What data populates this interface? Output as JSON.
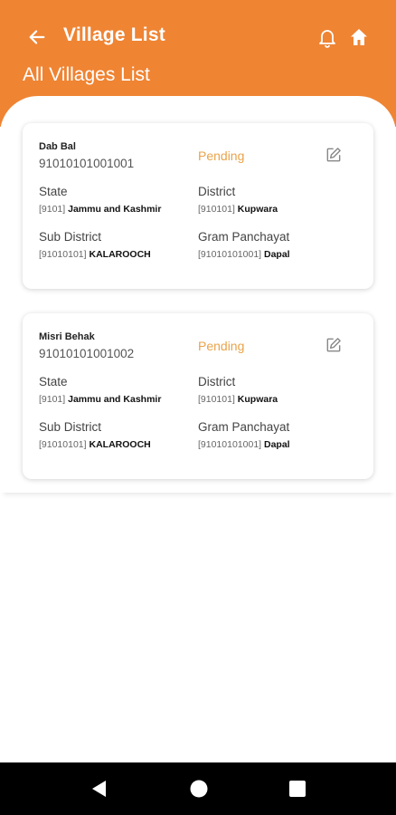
{
  "header": {
    "title": "Village List",
    "subtitle": "All Villages List",
    "icons": [
      "back-arrow-icon",
      "bell-icon",
      "home-icon"
    ],
    "accent_color": "#ef8433"
  },
  "villages": [
    {
      "name": "Dab Bal",
      "code": "91010101001001",
      "status": "Pending",
      "state_label": "State",
      "state_code": "[9101]",
      "state_name": "Jammu and Kashmir",
      "district_label": "District",
      "district_code": "[910101]",
      "district_name": "Kupwara",
      "subdistrict_label": "Sub District",
      "subdistrict_code": "[91010101]",
      "subdistrict_name": "KALAROOCH",
      "panchayat_label": "Gram Panchayat",
      "panchayat_code": "[91010101001]",
      "panchayat_name": "Dapal"
    },
    {
      "name": "Misri Behak",
      "code": "91010101001002",
      "status": "Pending",
      "state_label": "State",
      "state_code": "[9101]",
      "state_name": "Jammu and Kashmir",
      "district_label": "District",
      "district_code": "[910101]",
      "district_name": "Kupwara",
      "subdistrict_label": "Sub District",
      "subdistrict_code": "[91010101]",
      "subdistrict_name": "KALAROOCH",
      "panchayat_label": "Gram Panchayat",
      "panchayat_code": "[91010101001]",
      "panchayat_name": "Dapal"
    }
  ],
  "status_color": "#e9a34a",
  "navbar": {
    "icons": [
      "nav-back-icon",
      "nav-home-icon",
      "nav-recents-icon"
    ]
  }
}
